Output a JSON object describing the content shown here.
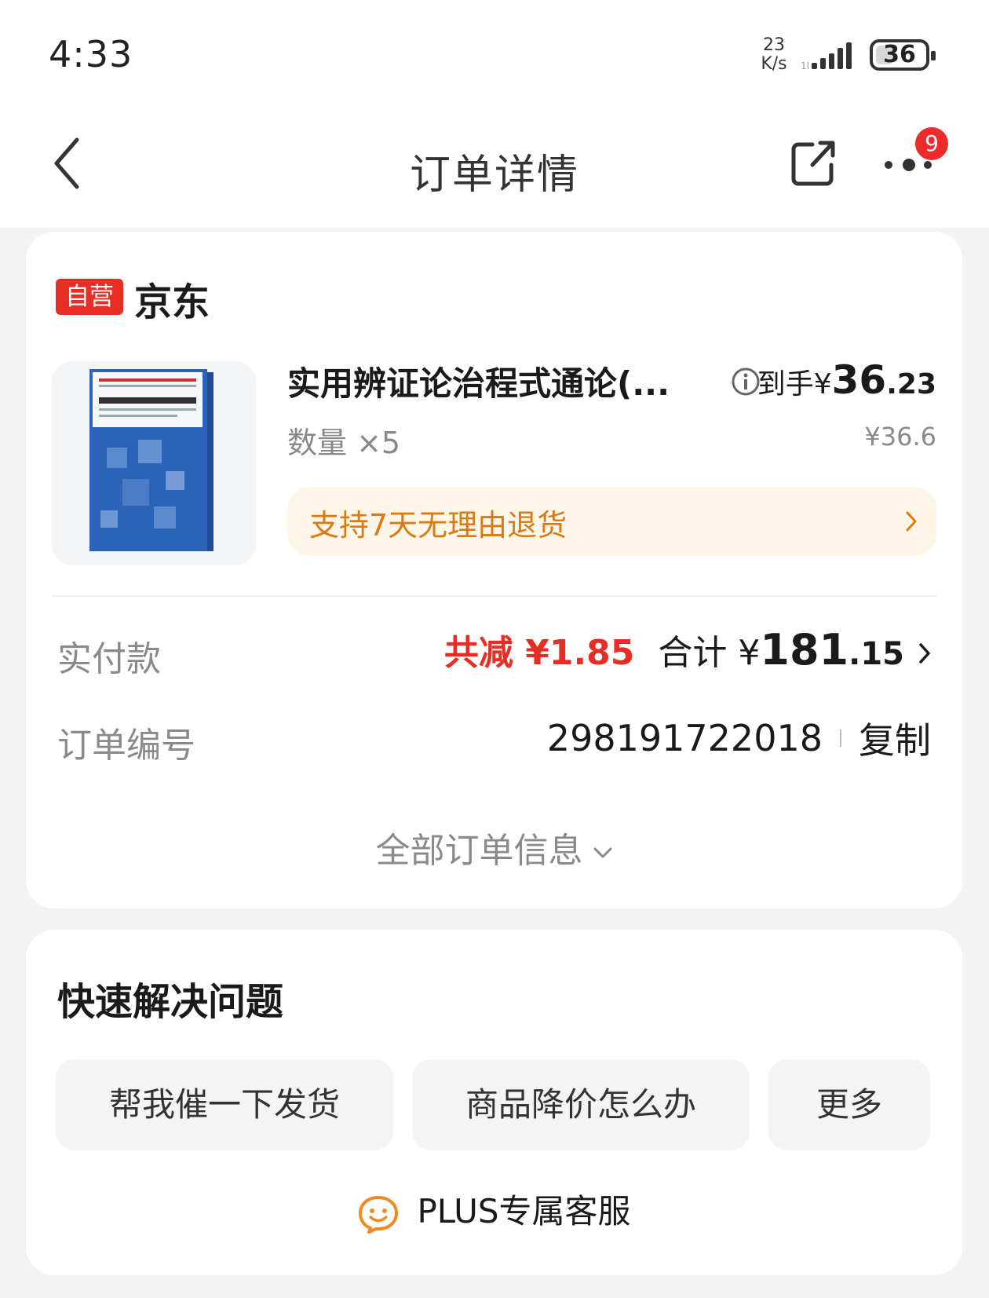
{
  "status_bar": {
    "time": "4:33",
    "net_speed_value": "23",
    "net_speed_unit": "K/s",
    "battery_level": "36",
    "battery_fraction": 0.36
  },
  "nav": {
    "title": "订单详情",
    "more_badge": "9",
    "icons": [
      "chevron-left-icon",
      "share-icon",
      "more-icon"
    ]
  },
  "order": {
    "self_tag": "自营",
    "shop_name": "京东",
    "product": {
      "title": "实用辨证论治程式通论(...",
      "cover_icon": "book-cover-image",
      "price_label": "到手¥",
      "price_integer": "36",
      "price_decimal": ".23",
      "original_price": "¥36.6",
      "quantity": "数量 ×5"
    },
    "return_policy": "支持7天无理由退货",
    "payment_label": "实付款",
    "discount": "共减 ¥1.85",
    "total_label": "合计 ¥",
    "total_integer": "181",
    "total_decimal": ".15",
    "order_number_label": "订单编号",
    "order_number": "298191722018",
    "copy_label": "复制",
    "all_info_label": "全部订单信息"
  },
  "quick_help": {
    "title": "快速解决问题",
    "buttons": [
      "帮我催一下发货",
      "商品降价怎么办",
      "更多"
    ],
    "service_label": "PLUS专属客服",
    "service_icon": "smiley-service-icon"
  },
  "colors": {
    "accent_red": "#e62e24",
    "return_orange": "#d97a12",
    "return_bg": "#fff6ea",
    "badge_red": "#ee2a2a",
    "service_icon": "#f28a24"
  }
}
